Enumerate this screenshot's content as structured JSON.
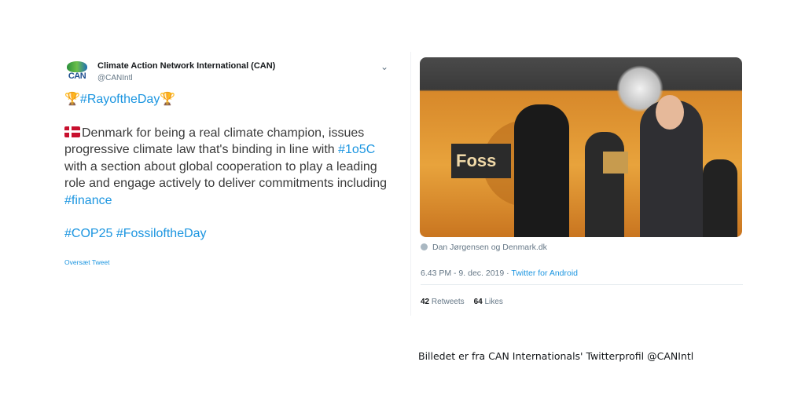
{
  "left_tweet": {
    "author_name": "Climate Action Network International (CAN)",
    "author_handle": "@CANIntl",
    "avatar_text": "CAN",
    "line1_tag": "#RayoftheDay",
    "para2_text_a": "Denmark for being a real climate champion, issues progressive climate law that's binding in line with ",
    "para2_tag1": "#1o5C",
    "para2_text_b": " with a section about global cooperation to play a leading role and engage actively to deliver commitments including ",
    "para2_tag2": "#finance",
    "para3_tag1": "#COP25",
    "para3_tag2": "#FossiloftheDay",
    "translate_label": "Oversæt Tweet"
  },
  "right_tweet": {
    "photo_banner_text": "Foss",
    "attribution": "Dan Jørgensen og Denmark.dk",
    "timestamp": "6.43 PM - 9. dec. 2019",
    "separator": " · ",
    "source": "Twitter for Android",
    "retweets_count": "42",
    "retweets_label": "Retweets",
    "likes_count": "64",
    "likes_label": "Likes"
  },
  "caption": "Billedet er fra CAN Internationals' Twitterprofil @CANIntl",
  "colors": {
    "link": "#1b95e0",
    "muted": "#657786",
    "flag_red": "#c8102e",
    "trophy": "#e0a21b"
  },
  "icons": {
    "trophy": "trophy-icon",
    "flag": "denmark-flag-icon",
    "chevron": "chevron-down-icon",
    "location": "location-pin-icon"
  }
}
